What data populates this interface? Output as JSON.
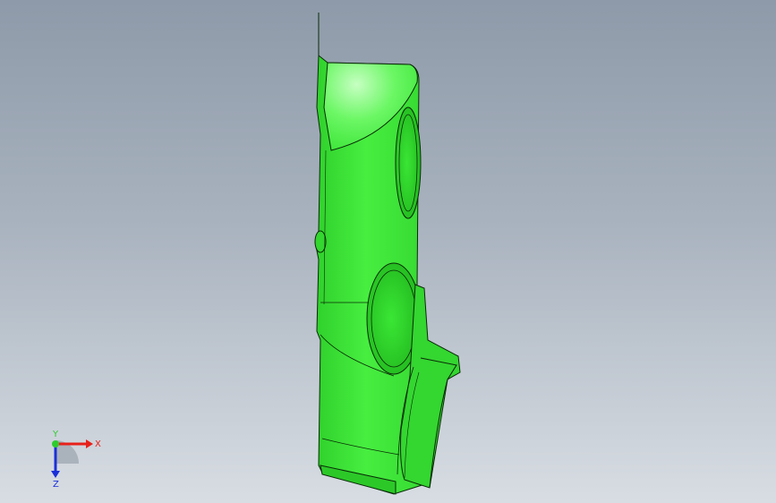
{
  "viewport": {
    "background_top": "#8e9aa9",
    "background_bottom": "#d8dde3"
  },
  "model": {
    "part_color": "#3ee63a",
    "highlight_color": "#8cff88",
    "shadow_color": "#1fb81c",
    "edge_color": "#0a2a08"
  },
  "triad": {
    "x_label": "X",
    "y_label": "Y",
    "z_label": "Z",
    "x_color": "#e8201a",
    "y_color": "#2ecc2e",
    "z_color": "#1a2fd8"
  }
}
